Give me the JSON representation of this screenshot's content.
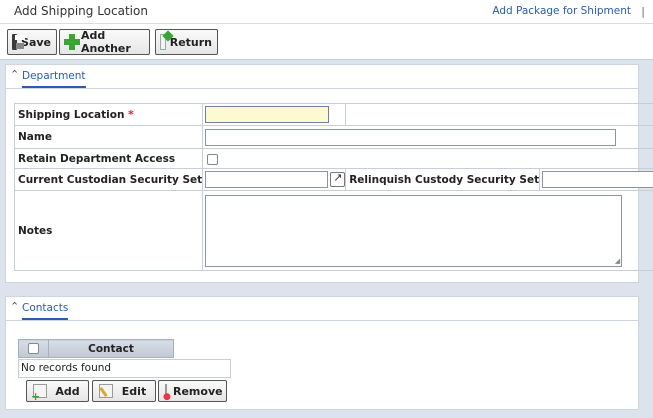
{
  "header": {
    "title": "Add Shipping Location",
    "link": "Add Package for Shipment",
    "separator": "|"
  },
  "toolbar": {
    "save_label": "Save",
    "add_another_label": "Add Another",
    "return_label": "Return"
  },
  "department": {
    "tab_label": "Department",
    "fields": {
      "shipping_location_label": "Shipping Location",
      "required_marker": "*",
      "name_label": "Name",
      "retain_access_label": "Retain Department Access",
      "current_custodian_label": "Current Custodian Security Set",
      "relinquish_custody_label": "Relinquish Custody Security Set",
      "notes_label": "Notes"
    },
    "values": {
      "shipping_location": "",
      "name": "",
      "retain_access": false,
      "current_custodian": "",
      "relinquish_custody": "",
      "notes": ""
    }
  },
  "contacts": {
    "tab_label": "Contacts",
    "columns": [
      "Contact"
    ],
    "empty_text": "No records found",
    "add_label": "Add",
    "edit_label": "Edit",
    "remove_label": "Remove"
  }
}
